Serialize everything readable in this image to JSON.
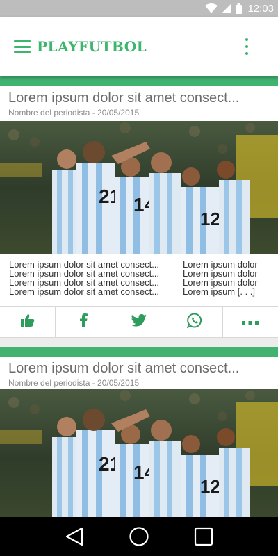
{
  "status_bar": {
    "time": "12:03",
    "icons": [
      "wifi-icon",
      "signal-icon",
      "battery-icon"
    ]
  },
  "app_bar": {
    "title": "PLAYFUTBOL",
    "menu_icon": "hamburger-menu-icon",
    "overflow_icon": "more-vert-icon"
  },
  "colors": {
    "accent": "#3db56c",
    "accent_bar": "#41b26f",
    "status_bar": "#bdbdbd",
    "nav_bar": "#000000"
  },
  "articles": [
    {
      "title": "Lorem ipsum dolor sit amet consect...",
      "meta": "Nombre del periodista - 20/05/2015",
      "image": "argentina-football-team-celebration-photo",
      "excerpt": {
        "col1": [
          "Lorem ipsum dolor sit amet consect...",
          "Lorem ipsum dolor sit amet consect...",
          "Lorem ipsum dolor sit amet consect...",
          "Lorem ipsum dolor sit amet consect..."
        ],
        "col2": [
          "Lorem ipsum dolor",
          "Lorem ipsum dolor",
          "Lorem ipsum dolor",
          "Lorem ipsum [. . .]"
        ]
      },
      "actions": [
        "thumbs-up-icon",
        "facebook-icon",
        "twitter-icon",
        "whatsapp-icon",
        "more-horiz-icon"
      ]
    },
    {
      "title": "Lorem ipsum dolor sit amet consect...",
      "meta": "Nombre del periodista - 20/05/2015",
      "image": "argentina-football-team-celebration-photo"
    }
  ],
  "nav_bar": {
    "buttons": [
      "back-icon",
      "home-icon",
      "recents-icon"
    ]
  }
}
